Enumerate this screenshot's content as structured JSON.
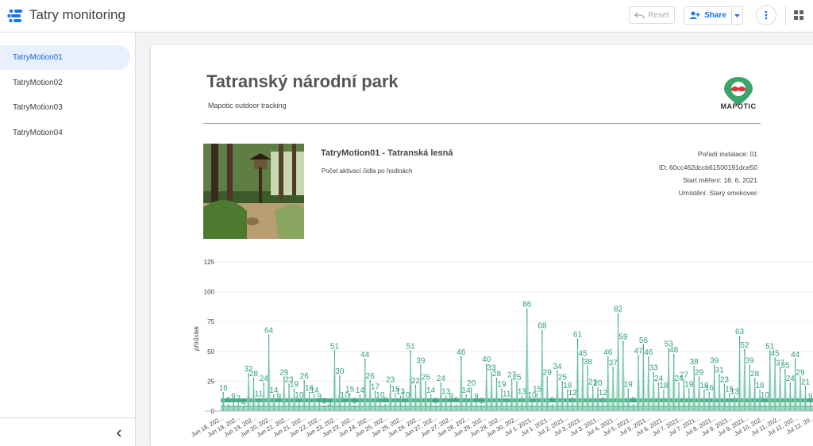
{
  "app": {
    "title": "Tatry monitoring"
  },
  "toolbar": {
    "reset_label": "Reset",
    "share_label": "Share"
  },
  "sidebar": {
    "items": [
      {
        "label": "TatryMotion01",
        "active": true
      },
      {
        "label": "TatryMotion02",
        "active": false
      },
      {
        "label": "TatryMotion03",
        "active": false
      },
      {
        "label": "TatryMotion04",
        "active": false
      }
    ]
  },
  "report": {
    "title": "Tatranský národní park",
    "subtitle": "Mapotic outdoor tracking",
    "logo_text": "MAPOTIC",
    "sensor_name": "TatryMotion01 - Tatranská lesná",
    "sensor_description": "Počet aktivací čidla po hodinách",
    "meta": {
      "order": "Pořadí instalace: 01",
      "id": "ID: 60cc462dccb61500191dce50",
      "start": "Start měření: 18. 6. 2021",
      "location": "Umístění: Starý smokovec"
    }
  },
  "colors": {
    "accent": "#1a73e8",
    "series": "#2e9e7a",
    "series_fill": "#8ed3b6",
    "logo_green": "#3aa66b",
    "logo_red": "#d93a36"
  },
  "chart_data": {
    "type": "area",
    "title": "",
    "ylabel": "přírůstek",
    "ylim": [
      0,
      125
    ],
    "yticks": [
      0,
      25,
      50,
      75,
      100,
      125
    ],
    "x_tick_labels": [
      "Jun 18, 202...",
      "Jun 19, 202...",
      "Jun 19, 202...",
      "Jun 20, 202...",
      "Jun 21, 202...",
      "Jun 21, 202...",
      "Jun 22, 202...",
      "Jun 23, 202...",
      "Jun 23, 202...",
      "Jun 24, 202...",
      "Jun 25, 202...",
      "Jun 25, 202...",
      "Jun 26, 202...",
      "Jun 27, 202...",
      "Jun 27, 202...",
      "Jun 28, 202...",
      "Jun 29, 202...",
      "Jun 29, 202...",
      "Jun 30, 202...",
      "Jul 1, 2021...",
      "Jul 1, 2021...",
      "Jul 2, 2021...",
      "Jul 3, 2021...",
      "Jul 3, 2021...",
      "Jul 4, 2021...",
      "Jul 5, 2021...",
      "Jul 5, 2021...",
      "Jul 6, 2021...",
      "Jul 7, 2021...",
      "Jul 7, 2021...",
      "Jul 8, 2021...",
      "Jul 9, 2021...",
      "Jul 9, 2021...",
      "Jul 10, 202...",
      "Jul 11, 202...",
      "Jul 11, 202...",
      "Jul 12, 20..."
    ],
    "peaks": [
      {
        "v": 16,
        "l": "16"
      },
      {
        "v": 6,
        "l": "6"
      },
      {
        "v": 9,
        "l": "9"
      },
      {
        "v": 7,
        "l": "7"
      },
      {
        "v": 4,
        "l": "4"
      },
      {
        "v": 32,
        "l": "32"
      },
      {
        "v": 28,
        "l": "28"
      },
      {
        "v": 11,
        "l": "11"
      },
      {
        "v": 24,
        "l": "24"
      },
      {
        "v": 64,
        "l": "64"
      },
      {
        "v": 14,
        "l": "14"
      },
      {
        "v": 9,
        "l": "9"
      },
      {
        "v": 29,
        "l": "29"
      },
      {
        "v": 23,
        "l": "23"
      },
      {
        "v": 19,
        "l": "19"
      },
      {
        "v": 10,
        "l": "10"
      },
      {
        "v": 26,
        "l": "26"
      },
      {
        "v": 16,
        "l": "16"
      },
      {
        "v": 14,
        "l": "14"
      },
      {
        "v": 9,
        "l": "9"
      },
      {
        "v": 5,
        "l": "5"
      },
      {
        "v": 3,
        "l": "3"
      },
      {
        "v": 51,
        "l": "51"
      },
      {
        "v": 30,
        "l": "30"
      },
      {
        "v": 10,
        "l": "10"
      },
      {
        "v": 15,
        "l": "15"
      },
      {
        "v": 5,
        "l": "5"
      },
      {
        "v": 14,
        "l": "14"
      },
      {
        "v": 44,
        "l": "44"
      },
      {
        "v": 26,
        "l": "26"
      },
      {
        "v": 17,
        "l": "17"
      },
      {
        "v": 10,
        "l": "10"
      },
      {
        "v": 6,
        "l": "6"
      },
      {
        "v": 23,
        "l": "23"
      },
      {
        "v": 15,
        "l": "15"
      },
      {
        "v": 13,
        "l": "13"
      },
      {
        "v": 10,
        "l": "10"
      },
      {
        "v": 51,
        "l": "51"
      },
      {
        "v": 22,
        "l": "22"
      },
      {
        "v": 39,
        "l": "39"
      },
      {
        "v": 25,
        "l": "25"
      },
      {
        "v": 14,
        "l": "14"
      },
      {
        "v": 5,
        "l": "5"
      },
      {
        "v": 24,
        "l": "24"
      },
      {
        "v": 13,
        "l": "13"
      },
      {
        "v": 9,
        "l": "9"
      },
      {
        "v": 6,
        "l": "6"
      },
      {
        "v": 46,
        "l": "46"
      },
      {
        "v": 14,
        "l": "14"
      },
      {
        "v": 20,
        "l": "20"
      },
      {
        "v": 9,
        "l": "9"
      },
      {
        "v": 5,
        "l": "5"
      },
      {
        "v": 40,
        "l": "40"
      },
      {
        "v": 33,
        "l": "33"
      },
      {
        "v": 28,
        "l": "28"
      },
      {
        "v": 19,
        "l": "19"
      },
      {
        "v": 11,
        "l": "11"
      },
      {
        "v": 27,
        "l": "27"
      },
      {
        "v": 25,
        "l": "25"
      },
      {
        "v": 13,
        "l": "13"
      },
      {
        "v": 86,
        "l": "86"
      },
      {
        "v": 10,
        "l": "10"
      },
      {
        "v": 15,
        "l": "15"
      },
      {
        "v": 68,
        "l": "68"
      },
      {
        "v": 29,
        "l": "29"
      },
      {
        "v": 6,
        "l": "6"
      },
      {
        "v": 34,
        "l": "34"
      },
      {
        "v": 25,
        "l": "25"
      },
      {
        "v": 18,
        "l": "18"
      },
      {
        "v": 12,
        "l": "12"
      },
      {
        "v": 61,
        "l": "61"
      },
      {
        "v": 45,
        "l": "45"
      },
      {
        "v": 38,
        "l": "38"
      },
      {
        "v": 21,
        "l": "21"
      },
      {
        "v": 20,
        "l": "20"
      },
      {
        "v": 12,
        "l": "12"
      },
      {
        "v": 46,
        "l": "46"
      },
      {
        "v": 37,
        "l": "37"
      },
      {
        "v": 82,
        "l": "82"
      },
      {
        "v": 59,
        "l": "59"
      },
      {
        "v": 19,
        "l": "19"
      },
      {
        "v": 6,
        "l": "6"
      },
      {
        "v": 47,
        "l": "47"
      },
      {
        "v": 56,
        "l": "56"
      },
      {
        "v": 46,
        "l": "46"
      },
      {
        "v": 33,
        "l": "33"
      },
      {
        "v": 24,
        "l": "24"
      },
      {
        "v": 18,
        "l": "18"
      },
      {
        "v": 53,
        "l": "53"
      },
      {
        "v": 48,
        "l": "48"
      },
      {
        "v": 24,
        "l": "24"
      },
      {
        "v": 27,
        "l": "27"
      },
      {
        "v": 19,
        "l": "19"
      },
      {
        "v": 38,
        "l": "38"
      },
      {
        "v": 29,
        "l": "29"
      },
      {
        "v": 18,
        "l": "18"
      },
      {
        "v": 16,
        "l": "16"
      },
      {
        "v": 39,
        "l": "39"
      },
      {
        "v": 31,
        "l": "31"
      },
      {
        "v": 23,
        "l": "23"
      },
      {
        "v": 15,
        "l": "15"
      },
      {
        "v": 13,
        "l": "13"
      },
      {
        "v": 63,
        "l": "63"
      },
      {
        "v": 52,
        "l": "52"
      },
      {
        "v": 39,
        "l": "39"
      },
      {
        "v": 28,
        "l": "28"
      },
      {
        "v": 18,
        "l": "18"
      },
      {
        "v": 10,
        "l": "10"
      },
      {
        "v": 51,
        "l": "51"
      },
      {
        "v": 45,
        "l": "45"
      },
      {
        "v": 37,
        "l": "37"
      },
      {
        "v": 35,
        "l": "35"
      },
      {
        "v": 24,
        "l": "24"
      },
      {
        "v": 44,
        "l": "44"
      },
      {
        "v": 29,
        "l": "29"
      },
      {
        "v": 21,
        "l": "21"
      },
      {
        "v": 9,
        "l": "9"
      }
    ]
  }
}
